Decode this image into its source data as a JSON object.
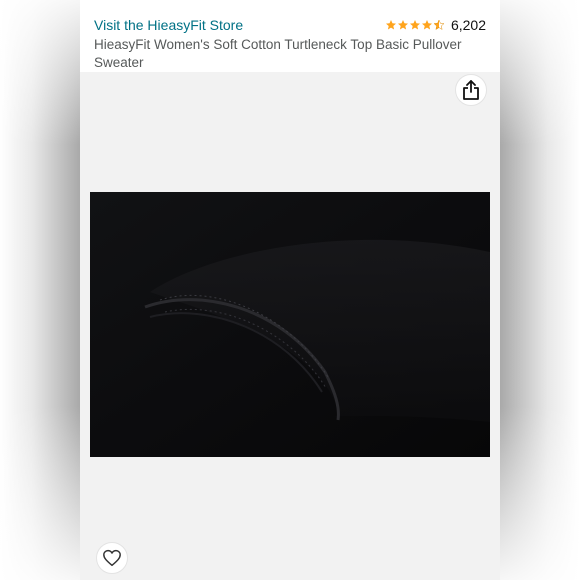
{
  "header": {
    "store_link": "Visit the HieasyFit Store",
    "rating_stars": 4.5,
    "rating_count": "6,202",
    "product_title": "HieasyFit Women's Soft Cotton Turtleneck Top Basic Pullover Sweater"
  },
  "icons": {
    "share": "share-icon",
    "wishlist": "heart-icon",
    "star": "star-icon"
  },
  "colors": {
    "link": "#007185",
    "star": "#FFA41C",
    "title": "#565959",
    "image_background": "#f2f2f2",
    "fabric": "#0b0b0d"
  }
}
